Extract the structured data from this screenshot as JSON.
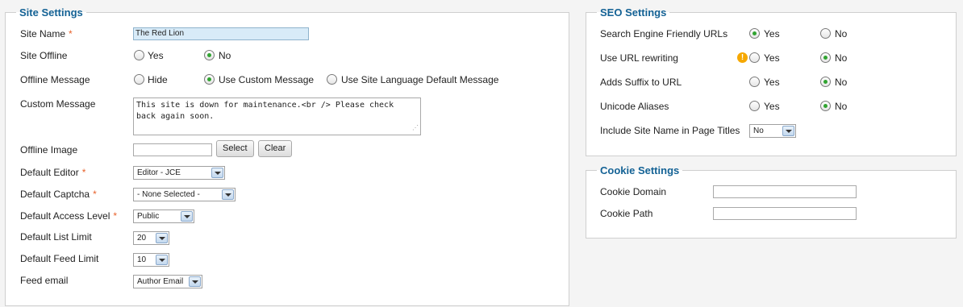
{
  "site_settings": {
    "legend": "Site Settings",
    "site_name": {
      "label": "Site Name",
      "required": "*",
      "value": "The Red Lion"
    },
    "site_offline": {
      "label": "Site Offline",
      "options": [
        "Yes",
        "No"
      ],
      "selected": "No"
    },
    "offline_message": {
      "label": "Offline Message",
      "options": [
        "Hide",
        "Use Custom Message",
        "Use Site Language Default Message"
      ],
      "selected": "Use Custom Message"
    },
    "custom_message": {
      "label": "Custom Message",
      "value": "This site is down for maintenance.<br /> Please check back again soon."
    },
    "offline_image": {
      "label": "Offline Image",
      "value": "",
      "select_label": "Select",
      "clear_label": "Clear"
    },
    "default_editor": {
      "label": "Default Editor",
      "required": "*",
      "value": "Editor - JCE"
    },
    "default_captcha": {
      "label": "Default Captcha",
      "required": "*",
      "value": "- None Selected -"
    },
    "default_access_level": {
      "label": "Default Access Level",
      "required": "*",
      "value": "Public"
    },
    "default_list_limit": {
      "label": "Default List Limit",
      "value": "20"
    },
    "default_feed_limit": {
      "label": "Default Feed Limit",
      "value": "10"
    },
    "feed_email": {
      "label": "Feed email",
      "value": "Author Email"
    }
  },
  "seo_settings": {
    "legend": "SEO Settings",
    "sef_urls": {
      "label": "Search Engine Friendly URLs",
      "options": [
        "Yes",
        "No"
      ],
      "selected": "Yes"
    },
    "url_rewriting": {
      "label": "Use URL rewriting",
      "options": [
        "Yes",
        "No"
      ],
      "selected": "No",
      "warning_icon": "warning-icon"
    },
    "suffix": {
      "label": "Adds Suffix to URL",
      "options": [
        "Yes",
        "No"
      ],
      "selected": "No"
    },
    "unicode": {
      "label": "Unicode Aliases",
      "options": [
        "Yes",
        "No"
      ],
      "selected": "No"
    },
    "sitename_titles": {
      "label": "Include Site Name in Page Titles",
      "value": "No"
    }
  },
  "cookie_settings": {
    "legend": "Cookie Settings",
    "domain": {
      "label": "Cookie Domain",
      "value": ""
    },
    "path": {
      "label": "Cookie Path",
      "value": ""
    }
  },
  "colors": {
    "legend": "#146295",
    "required": "#e8622b",
    "radio_on": "#31a431",
    "highlight": "#d8ebf8"
  }
}
